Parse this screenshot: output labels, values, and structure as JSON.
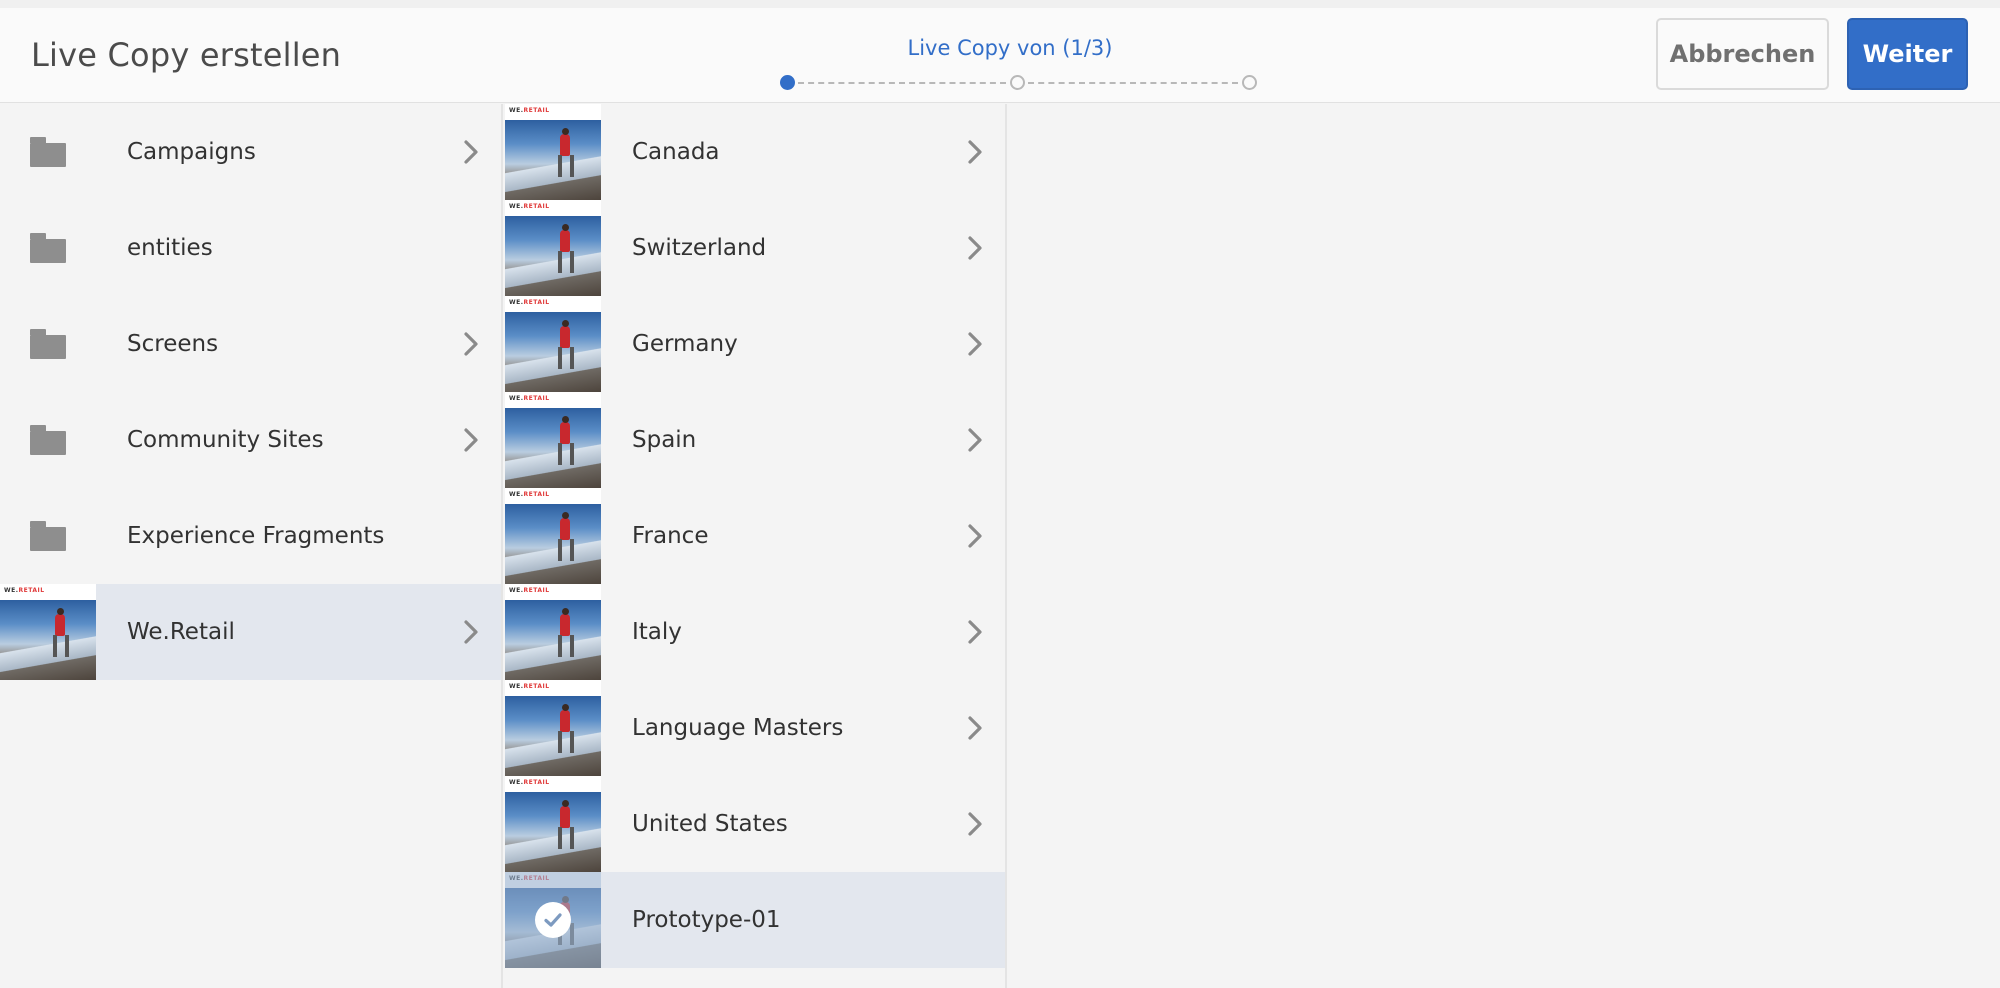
{
  "header": {
    "title": "Live Copy erstellen",
    "step_label": "Live Copy von (1/3)",
    "cancel_label": "Abbrechen",
    "next_label": "Weiter",
    "steps": [
      {
        "state": "active"
      },
      {
        "state": "inactive"
      },
      {
        "state": "inactive"
      }
    ]
  },
  "colors": {
    "accent": "#326ec8",
    "selected_row": "#e3e7ee",
    "folder_icon": "#8e8e8e"
  },
  "column1": {
    "items": [
      {
        "label": "Campaigns",
        "icon": "folder-icon",
        "has_children": true,
        "selected": false
      },
      {
        "label": "entities",
        "icon": "folder-icon",
        "has_children": false,
        "selected": false
      },
      {
        "label": "Screens",
        "icon": "folder-icon",
        "has_children": true,
        "selected": false
      },
      {
        "label": "Community Sites",
        "icon": "folder-icon",
        "has_children": true,
        "selected": false
      },
      {
        "label": "Experience Fragments",
        "icon": "folder-icon",
        "has_children": false,
        "selected": false
      },
      {
        "label": "We.Retail",
        "icon": "page-thumbnail",
        "has_children": true,
        "selected": true
      }
    ]
  },
  "column2": {
    "items": [
      {
        "label": "Canada",
        "icon": "page-thumbnail",
        "has_children": true,
        "selected": false
      },
      {
        "label": "Switzerland",
        "icon": "page-thumbnail",
        "has_children": true,
        "selected": false
      },
      {
        "label": "Germany",
        "icon": "page-thumbnail",
        "has_children": true,
        "selected": false
      },
      {
        "label": "Spain",
        "icon": "page-thumbnail",
        "has_children": true,
        "selected": false
      },
      {
        "label": "France",
        "icon": "page-thumbnail",
        "has_children": true,
        "selected": false
      },
      {
        "label": "Italy",
        "icon": "page-thumbnail",
        "has_children": true,
        "selected": false
      },
      {
        "label": "Language Masters",
        "icon": "page-thumbnail",
        "has_children": true,
        "selected": false
      },
      {
        "label": "United States",
        "icon": "page-thumbnail",
        "has_children": true,
        "selected": false
      },
      {
        "label": "Prototype-01",
        "icon": "check-icon",
        "has_children": false,
        "selected": true
      }
    ]
  },
  "thumbnail_brand": {
    "prefix": "WE.",
    "name": "RETAIL"
  }
}
